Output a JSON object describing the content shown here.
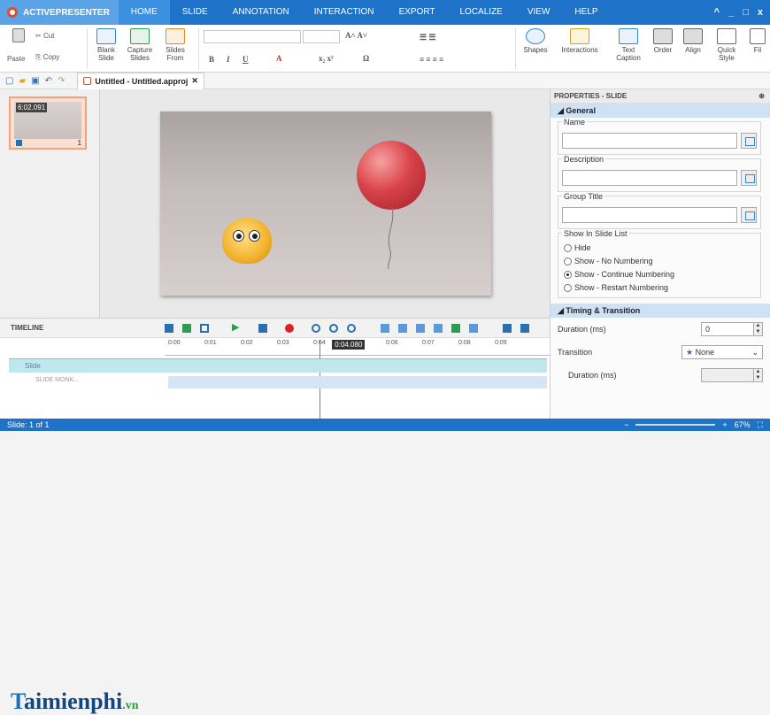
{
  "app": {
    "name": "ACTIVEPRESENTER"
  },
  "menu": [
    "HOME",
    "SLIDE",
    "ANNOTATION",
    "INTERACTION",
    "EXPORT",
    "LOCALIZE",
    "VIEW",
    "HELP"
  ],
  "window_controls": [
    "^",
    "_",
    "□",
    "x"
  ],
  "ribbon": {
    "paste": "Paste",
    "cut": "Cut",
    "copy": "Copy",
    "blank_slide": [
      "Blank",
      "Slide"
    ],
    "capture_slides": [
      "Capture",
      "Slides"
    ],
    "slides_from": [
      "Slides",
      "From"
    ],
    "shapes": "Shapes",
    "interactions": "Interactions",
    "text_caption": [
      "Text",
      "Caption"
    ],
    "order": "Order",
    "align": "Align",
    "quick_style": [
      "Quick",
      "Style"
    ],
    "fill": "Fil"
  },
  "document_tab": {
    "title": "Untitled - Untitled.approj"
  },
  "thumbnail": {
    "time": "6:02.091",
    "number": "1"
  },
  "properties": {
    "header": "PROPERTIES - SLIDE",
    "general": "General",
    "name_label": "Name",
    "description_label": "Description",
    "group_title_label": "Group Title",
    "show_list_label": "Show In Slide List",
    "options": [
      "Hide",
      "Show - No Numbering",
      "Show - Continue Numbering",
      "Show - Restart Numbering"
    ],
    "selected_option": "Show - Continue Numbering",
    "timing_section": "Timing & Transition",
    "duration_label": "Duration (ms)",
    "duration_value": "0",
    "transition_label": "Transition",
    "transition_value": "None",
    "transition_duration_label": "Duration (ms)"
  },
  "timeline": {
    "label": "TIMELINE",
    "ticks": [
      "0:00",
      "0:01",
      "0:02",
      "0:03",
      "0:04",
      "0:05",
      "0:06",
      "0:07",
      "0:08",
      "0:09"
    ],
    "playhead_label": "0:04.080",
    "playhead_seconds": 4.08,
    "slide_track": "Slide",
    "track2": "SLIDE MONK..."
  },
  "status": {
    "left": "Slide: 1 of 1",
    "zoom": "67%"
  },
  "watermark": {
    "text": "aimienphi",
    "initial": "T",
    "suffix": ".vn"
  }
}
